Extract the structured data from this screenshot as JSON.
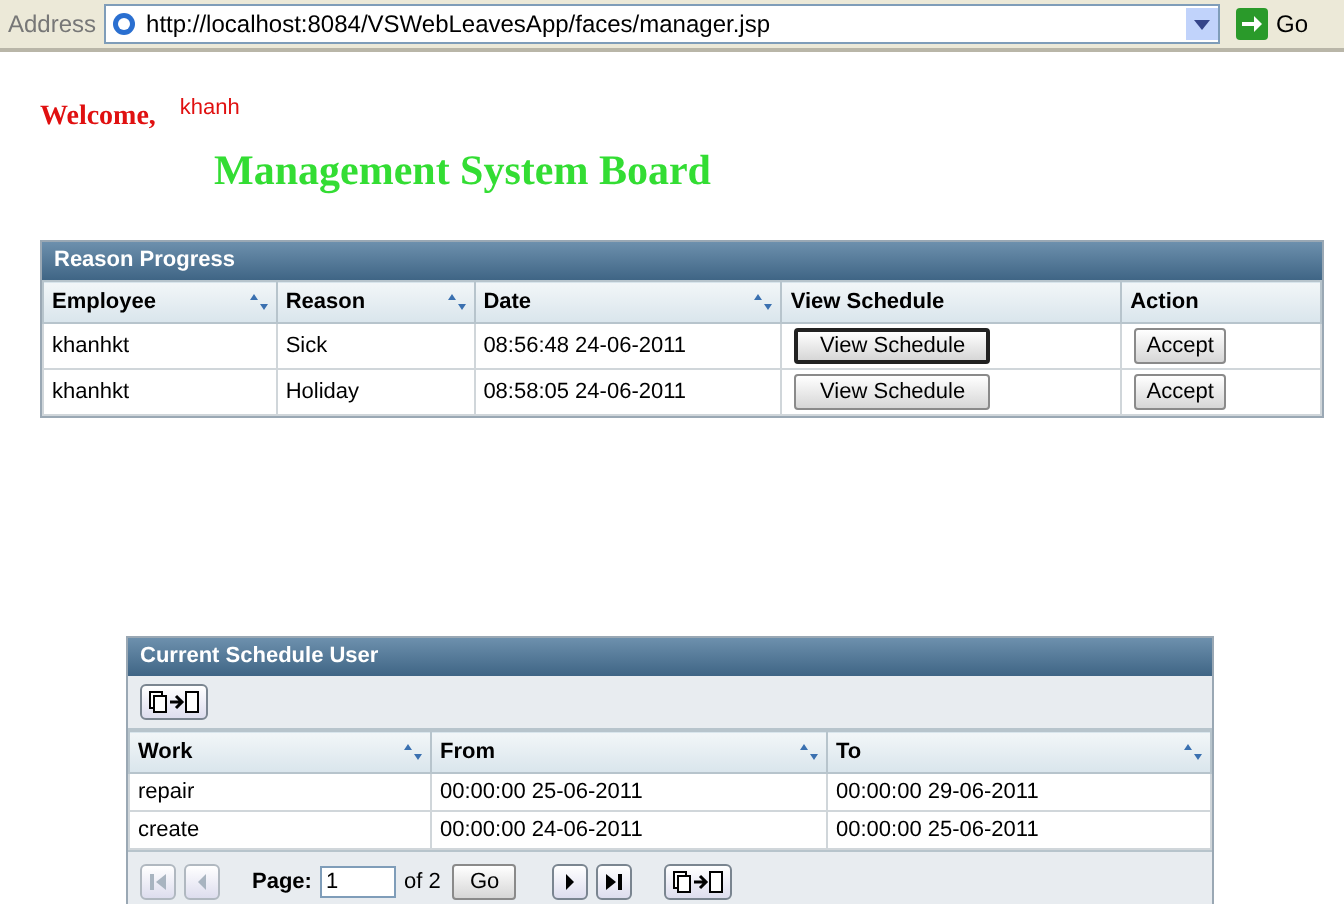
{
  "address_bar": {
    "label": "Address",
    "url": "http://localhost:8084/VSWebLeavesApp/faces/manager.jsp",
    "go_label": "Go"
  },
  "welcome": {
    "label": "Welcome,",
    "user": "khanh"
  },
  "heading": "Management System Board",
  "reason_table": {
    "title": "Reason Progress",
    "columns": [
      {
        "label": "Employee",
        "sortable": true
      },
      {
        "label": "Reason",
        "sortable": true
      },
      {
        "label": "Date",
        "sortable": true
      },
      {
        "label": "View Schedule",
        "sortable": false
      },
      {
        "label": "Action",
        "sortable": false
      }
    ],
    "rows": [
      {
        "employee": "khanhkt",
        "reason": "Sick",
        "date": "08:56:48 24-06-2011",
        "view_label": "View Schedule",
        "view_focused": true,
        "action_label": "Accept"
      },
      {
        "employee": "khanhkt",
        "reason": "Holiday",
        "date": "08:58:05 24-06-2011",
        "view_label": "View Schedule",
        "view_focused": false,
        "action_label": "Accept"
      }
    ]
  },
  "schedule_table": {
    "title": "Current Schedule User",
    "columns": [
      {
        "label": "Work",
        "sortable": true
      },
      {
        "label": "From",
        "sortable": true
      },
      {
        "label": "To",
        "sortable": true
      }
    ],
    "rows": [
      [
        "repair",
        "00:00:00 25-06-2011",
        "00:00:00 29-06-2011"
      ],
      [
        "create",
        "00:00:00 24-06-2011",
        "00:00:00 25-06-2011"
      ]
    ],
    "pager": {
      "first_disabled": true,
      "prev_disabled": true,
      "next_disabled": false,
      "last_disabled": false,
      "page_label": "Page:",
      "page_value": "1",
      "of_label": "of 2",
      "go_label": "Go"
    }
  }
}
